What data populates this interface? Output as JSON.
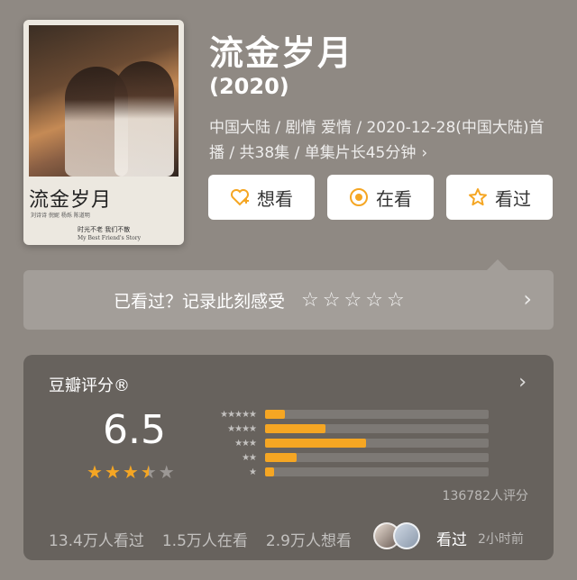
{
  "poster": {
    "title": "流金岁月",
    "credits": "刘诗诗  倪妮  杨烁  陈道明",
    "tagline": "时光不老  我们不散",
    "subtitle": "My Best Friend's Story"
  },
  "show": {
    "title": "流金岁月",
    "year": "(2020)",
    "meta": "中国大陆 / 剧情 爱情 / 2020-12-28(中国大陆)首播 / 共38集 / 单集片长45分钟",
    "meta_chevron": "›"
  },
  "actions": [
    {
      "label": "想看",
      "icon": "heart-plus-icon",
      "glyph": "♡"
    },
    {
      "label": "在看",
      "icon": "target-circle-icon",
      "glyph": "◉"
    },
    {
      "label": "看过",
      "icon": "star-outline-icon",
      "glyph": "☆"
    }
  ],
  "record": {
    "label": "已看过？记录此刻感受",
    "stars": [
      "☆",
      "☆",
      "☆",
      "☆",
      "☆"
    ],
    "arrow": "›"
  },
  "rating": {
    "header": "豆瓣评分®",
    "header_arrow": "›",
    "score": "6.5",
    "score_stars": [
      "full",
      "full",
      "full",
      "half",
      "empty"
    ],
    "distribution": [
      {
        "stars": "★★★★★",
        "fraction": 0.09
      },
      {
        "stars": "★★★★",
        "fraction": 0.27
      },
      {
        "stars": "★★★",
        "fraction": 0.45
      },
      {
        "stars": "★★",
        "fraction": 0.14
      },
      {
        "stars": "★",
        "fraction": 0.04
      }
    ],
    "count_text": "136782人评分",
    "stats": [
      "13.4万人看过",
      "1.5万人在看",
      "2.9万人想看"
    ],
    "watched_label": "看过",
    "watched_time": "2小时前"
  },
  "colors": {
    "accent": "#f5a623",
    "background": "#8f8983"
  }
}
